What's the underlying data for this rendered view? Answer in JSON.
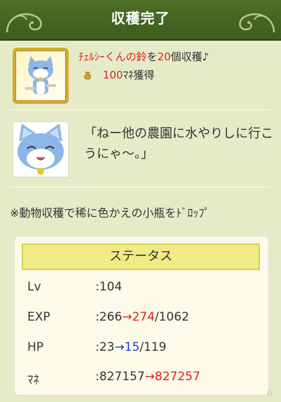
{
  "header": {
    "title": "収穫完了"
  },
  "reward": {
    "item_name": "ﾁｪﾙｼｰくんの鈴",
    "mid": "を",
    "count": "20",
    "suffix": "個収穫♪",
    "money_amount": "100",
    "money_suffix": "ﾏﾈ獲得"
  },
  "speech": {
    "text": "「ねー他の農園に水やりしに行こうにゃ〜。」"
  },
  "note": {
    "text": "※動物収穫で稀に色かえの小瓶をﾄﾞﾛｯﾌﾟ"
  },
  "status": {
    "heading": "ステータス",
    "rows": [
      {
        "label": "Lv",
        "prefix": ":104",
        "old": "",
        "arrow": "",
        "new": "",
        "rest": ""
      },
      {
        "label": "EXP",
        "prefix": ":",
        "old": "266",
        "arrow": "→",
        "new": "274",
        "rest": "/1062"
      },
      {
        "label": "HP",
        "prefix": ":",
        "old": "23",
        "arrow": "→",
        "new": "15",
        "rest": "/119"
      },
      {
        "label": "ﾏﾈ",
        "prefix": ":",
        "old": "827157",
        "arrow": "→",
        "new": "827257",
        "rest": ""
      }
    ]
  },
  "watermark": "G"
}
